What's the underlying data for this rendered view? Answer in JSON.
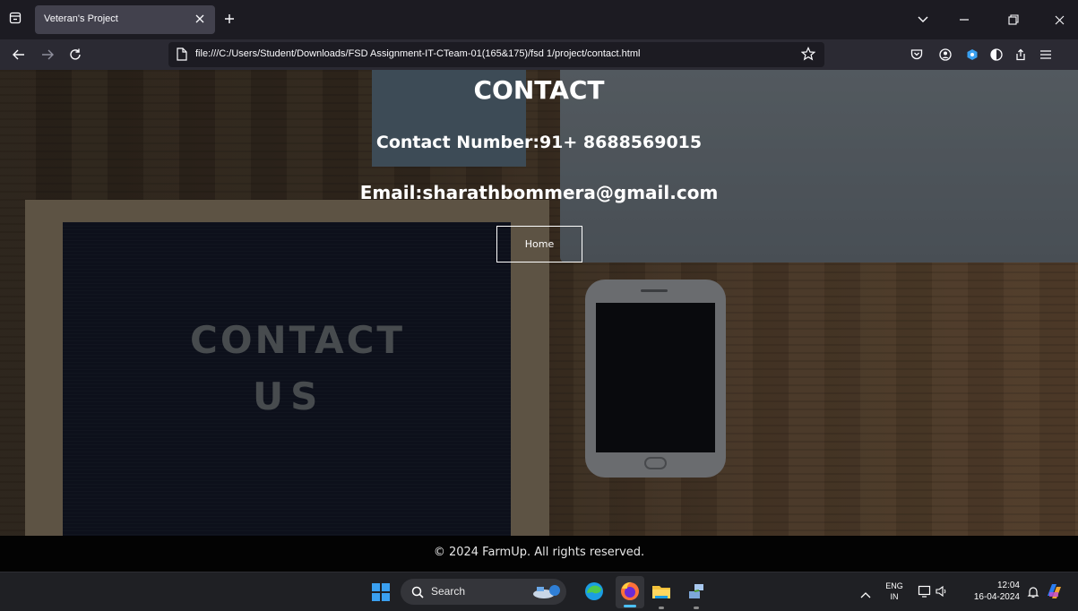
{
  "browser": {
    "tab_title": "Veteran's Project",
    "url": "file:///C:/Users/Student/Downloads/FSD Assignment-IT-CTeam-01(165&175)/fsd 1/project/contact.html"
  },
  "page": {
    "heading": "CONTACT",
    "contact_number": "Contact Number:91+ 8688569015",
    "email": "Email:sharathbommera@gmail.com",
    "home_button": "Home",
    "background_board_line1": "CONTACT",
    "background_board_line2": "US",
    "footer": "© 2024 FarmUp. All rights reserved."
  },
  "taskbar": {
    "search_label": "Search",
    "language_line1": "ENG",
    "language_line2": "IN",
    "time": "12:04",
    "date": "16-04-2024"
  },
  "colors": {
    "browser_bg": "#1c1b22",
    "toolbar_bg": "#2b2a33",
    "footer_bg": "#030303",
    "taskbar_bg": "#1f2024",
    "accent_blue": "#3aa0f0"
  },
  "icons": [
    "tab-list-icon",
    "close-icon",
    "plus-icon",
    "chevron-down-icon",
    "minimize-icon",
    "restore-icon",
    "back-arrow-icon",
    "forward-arrow-icon",
    "reload-icon",
    "page-icon",
    "star-icon",
    "pocket-icon",
    "account-icon",
    "extension-icon",
    "contrast-icon",
    "share-icon",
    "menu-icon",
    "windows-icon",
    "search-icon",
    "edge-icon",
    "firefox-icon",
    "file-explorer-icon",
    "network-icon",
    "bell-icon",
    "copilot-icon"
  ]
}
